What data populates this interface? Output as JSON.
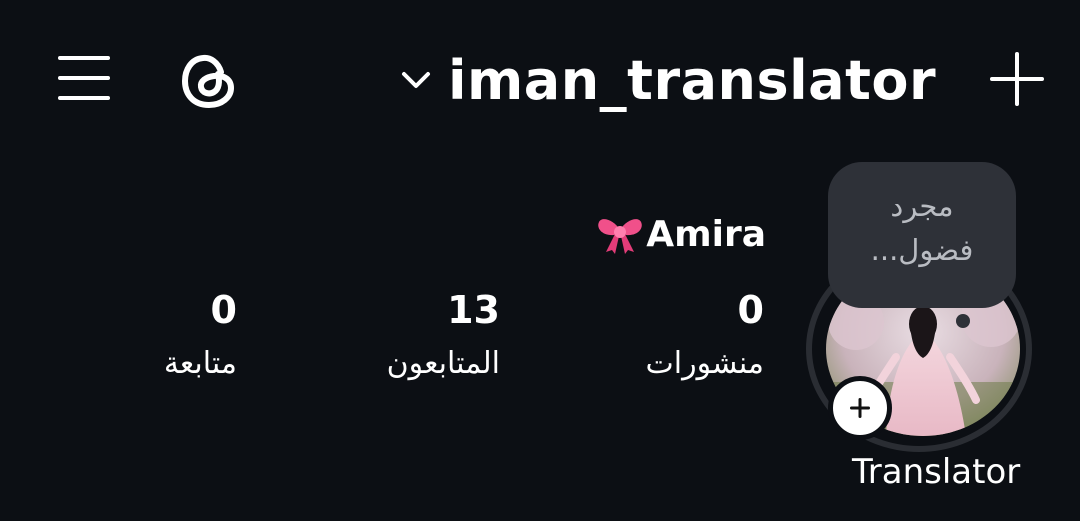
{
  "header": {
    "menu_icon": "hamburger-menu-icon",
    "logo_icon": "threads-logo-icon",
    "username": "iman_translator",
    "switcher_icon": "chevron-down-icon",
    "new_icon": "plus-icon"
  },
  "profile": {
    "display_name": "Amira",
    "display_name_emoji": "ribbon-bow",
    "note": "مجرد فضول...",
    "avatar_caption": "Translator",
    "add_story_icon": "plus-icon",
    "stats": {
      "posts": {
        "value": "0",
        "label": "منشورات"
      },
      "followers": {
        "value": "13",
        "label": "المتابعون"
      },
      "following": {
        "value": "0",
        "label": "متابعة"
      }
    }
  },
  "colors": {
    "background": "#0c0f14",
    "text": "#ffffff",
    "bubble": "#2e3138",
    "bubble_text": "#b9bcc2",
    "ribbon": "#f0508a"
  }
}
